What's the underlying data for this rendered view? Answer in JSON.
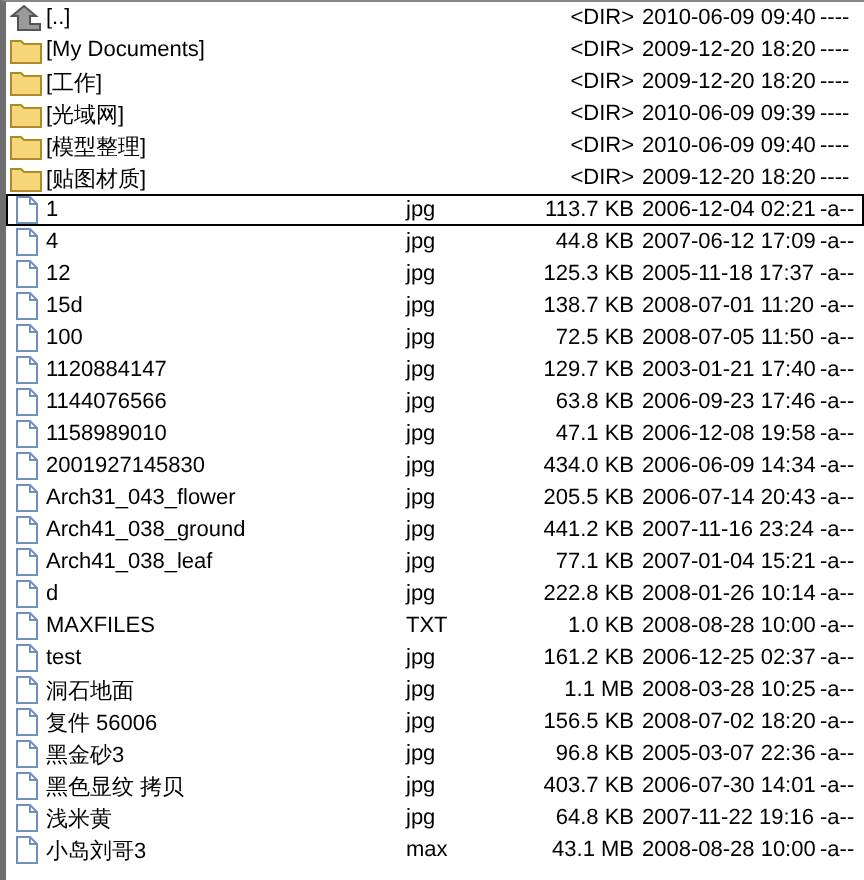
{
  "files": [
    {
      "kind": "up",
      "name": "[..]",
      "size": "<DIR>",
      "date": "2010-06-09 09:40",
      "attr": "----",
      "focused": false
    },
    {
      "kind": "dir",
      "name": "[My Documents]",
      "size": "<DIR>",
      "date": "2009-12-20 18:20",
      "attr": "----",
      "focused": false
    },
    {
      "kind": "dir",
      "name": "[工作]",
      "size": "<DIR>",
      "date": "2009-12-20 18:20",
      "attr": "----",
      "focused": false
    },
    {
      "kind": "dir",
      "name": "[光域网]",
      "size": "<DIR>",
      "date": "2010-06-09 09:39",
      "attr": "----",
      "focused": false
    },
    {
      "kind": "dir",
      "name": "[模型整理]",
      "size": "<DIR>",
      "date": "2010-06-09 09:40",
      "attr": "----",
      "focused": false
    },
    {
      "kind": "dir",
      "name": "[贴图材质]",
      "size": "<DIR>",
      "date": "2009-12-20 18:20",
      "attr": "----",
      "focused": false
    },
    {
      "kind": "file",
      "name": "1",
      "ext": "jpg",
      "size": "113.7 KB",
      "date": "2006-12-04 02:21",
      "attr": "-a--",
      "focused": true
    },
    {
      "kind": "file",
      "name": "4",
      "ext": "jpg",
      "size": "44.8 KB",
      "date": "2007-06-12 17:09",
      "attr": "-a--",
      "focused": false
    },
    {
      "kind": "file",
      "name": "12",
      "ext": "jpg",
      "size": "125.3 KB",
      "date": "2005-11-18 17:37",
      "attr": "-a--",
      "focused": false
    },
    {
      "kind": "file",
      "name": "15d",
      "ext": "jpg",
      "size": "138.7 KB",
      "date": "2008-07-01 11:20",
      "attr": "-a--",
      "focused": false
    },
    {
      "kind": "file",
      "name": "100",
      "ext": "jpg",
      "size": "72.5 KB",
      "date": "2008-07-05 11:50",
      "attr": "-a--",
      "focused": false
    },
    {
      "kind": "file",
      "name": "1120884147",
      "ext": "jpg",
      "size": "129.7 KB",
      "date": "2003-01-21 17:40",
      "attr": "-a--",
      "focused": false
    },
    {
      "kind": "file",
      "name": "1144076566",
      "ext": "jpg",
      "size": "63.8 KB",
      "date": "2006-09-23 17:46",
      "attr": "-a--",
      "focused": false
    },
    {
      "kind": "file",
      "name": "1158989010",
      "ext": "jpg",
      "size": "47.1 KB",
      "date": "2006-12-08 19:58",
      "attr": "-a--",
      "focused": false
    },
    {
      "kind": "file",
      "name": "2001927145830",
      "ext": "jpg",
      "size": "434.0 KB",
      "date": "2006-06-09 14:34",
      "attr": "-a--",
      "focused": false
    },
    {
      "kind": "file",
      "name": "Arch31_043_flower",
      "ext": "jpg",
      "size": "205.5 KB",
      "date": "2006-07-14 20:43",
      "attr": "-a--",
      "focused": false
    },
    {
      "kind": "file",
      "name": "Arch41_038_ground",
      "ext": "jpg",
      "size": "441.2 KB",
      "date": "2007-11-16 23:24",
      "attr": "-a--",
      "focused": false
    },
    {
      "kind": "file",
      "name": "Arch41_038_leaf",
      "ext": "jpg",
      "size": "77.1 KB",
      "date": "2007-01-04 15:21",
      "attr": "-a--",
      "focused": false
    },
    {
      "kind": "file",
      "name": "d",
      "ext": "jpg",
      "size": "222.8 KB",
      "date": "2008-01-26 10:14",
      "attr": "-a--",
      "focused": false
    },
    {
      "kind": "file",
      "name": "MAXFILES",
      "ext": "TXT",
      "size": "1.0 KB",
      "date": "2008-08-28 10:00",
      "attr": "-a--",
      "focused": false
    },
    {
      "kind": "file",
      "name": "test",
      "ext": "jpg",
      "size": "161.2 KB",
      "date": "2006-12-25 02:37",
      "attr": "-a--",
      "focused": false
    },
    {
      "kind": "file",
      "name": "洞石地面",
      "ext": "jpg",
      "size": "1.1 MB",
      "date": "2008-03-28 10:25",
      "attr": "-a--",
      "focused": false
    },
    {
      "kind": "file",
      "name": "复件 56006",
      "ext": "jpg",
      "size": "156.5 KB",
      "date": "2008-07-02 18:20",
      "attr": "-a--",
      "focused": false
    },
    {
      "kind": "file",
      "name": "黑金砂3",
      "ext": "jpg",
      "size": "96.8 KB",
      "date": "2005-03-07 22:36",
      "attr": "-a--",
      "focused": false
    },
    {
      "kind": "file",
      "name": "黑色显纹 拷贝",
      "ext": "jpg",
      "size": "403.7 KB",
      "date": "2006-07-30 14:01",
      "attr": "-a--",
      "focused": false
    },
    {
      "kind": "file",
      "name": "浅米黄",
      "ext": "jpg",
      "size": "64.8 KB",
      "date": "2007-11-22 19:16",
      "attr": "-a--",
      "focused": false
    },
    {
      "kind": "file",
      "name": "小岛刘哥3",
      "ext": "max",
      "size": "43.1 MB",
      "date": "2008-08-28 10:00",
      "attr": "-a--",
      "focused": false
    }
  ]
}
